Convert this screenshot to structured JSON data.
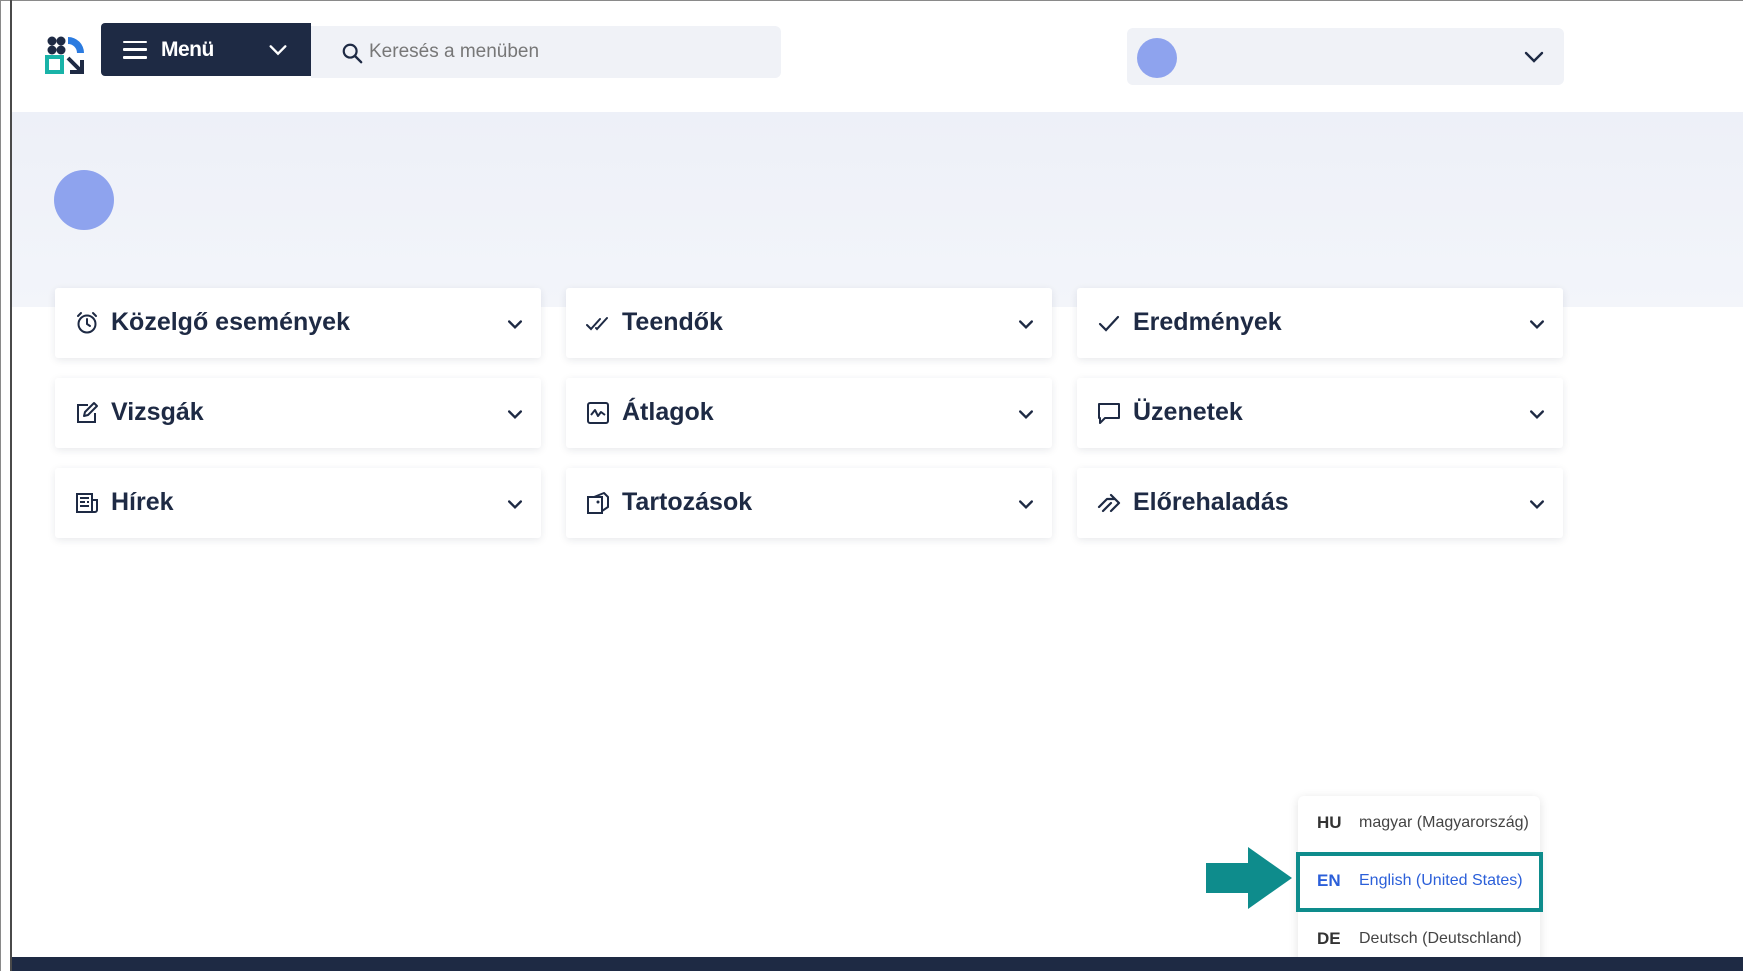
{
  "header": {
    "menu_label": "Menü",
    "search_placeholder": "Keresés a menüben"
  },
  "widgets": [
    {
      "title": "Közelgő események",
      "icon": "alarm-clock-icon"
    },
    {
      "title": "Teendők",
      "icon": "double-check-icon"
    },
    {
      "title": "Eredmények",
      "icon": "check-icon"
    },
    {
      "title": "Vizsgák",
      "icon": "edit-note-icon"
    },
    {
      "title": "Átlagok",
      "icon": "chart-line-icon"
    },
    {
      "title": "Üzenetek",
      "icon": "chat-bubble-icon"
    },
    {
      "title": "Hírek",
      "icon": "newspaper-icon"
    },
    {
      "title": "Tartozások",
      "icon": "tag-icon"
    },
    {
      "title": "Előrehaladás",
      "icon": "double-arrow-right-icon"
    }
  ],
  "language_menu": {
    "items": [
      {
        "code": "HU",
        "name": "magyar (Magyarország)"
      },
      {
        "code": "EN",
        "name": "English (United States)",
        "selected": true
      },
      {
        "code": "DE",
        "name": "Deutsch (Deutschland)"
      }
    ]
  },
  "colors": {
    "navy": "#1e2a44",
    "accent_blue": "#2b5fd9",
    "avatar": "#8ea3ee",
    "teal_highlight": "#0e8c8c"
  }
}
